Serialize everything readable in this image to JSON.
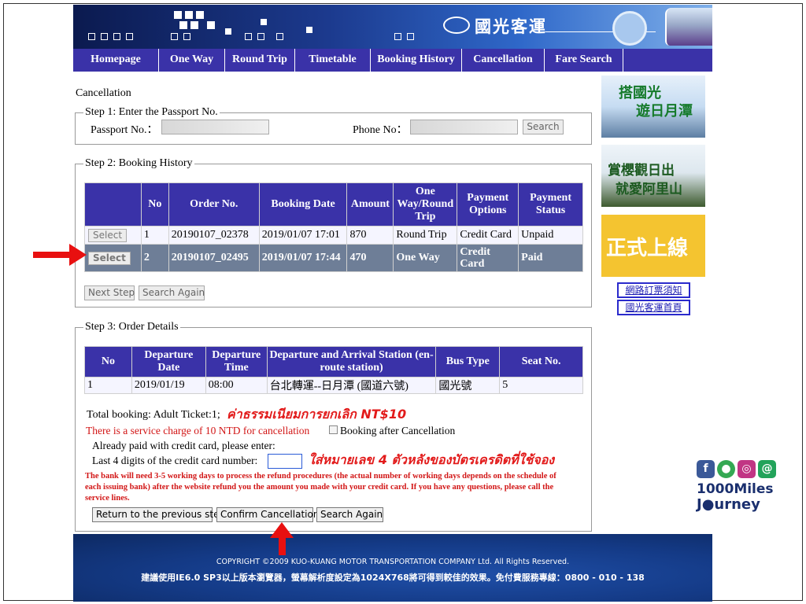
{
  "banner": {
    "logo_text": "國光客運"
  },
  "nav": [
    "Homepage",
    "One Way",
    "Round Trip",
    "Timetable",
    "Booking History",
    "Cancellation",
    "Fare Search"
  ],
  "page_title": "Cancellation",
  "step1": {
    "legend": "Step 1: Enter the Passport No.",
    "passport_label": "Passport No.：",
    "phone_label": "Phone No：",
    "search_button": "Search"
  },
  "step2": {
    "legend": "Step 2: Booking History",
    "headers": [
      "",
      "No",
      "Order No.",
      "Booking Date",
      "Amount",
      "One Way/Round Trip",
      "Payment Options",
      "Payment Status"
    ],
    "select_label": "Select",
    "rows": [
      {
        "no": "1",
        "order": "20190107_02378",
        "date": "2019/01/07 17:01",
        "amount": "870",
        "trip": "Round Trip",
        "payment": "Credit Card",
        "status": "Unpaid"
      },
      {
        "no": "2",
        "order": "20190107_02495",
        "date": "2019/01/07 17:44",
        "amount": "470",
        "trip": "One Way",
        "payment": "Credit Card",
        "status": "Paid"
      }
    ],
    "next_step": "Next Step",
    "search_again": "Search Again"
  },
  "step3": {
    "legend": "Step 3: Order Details",
    "headers": [
      "No",
      "Departure Date",
      "Departure Time",
      "Departure and Arrival Station (en-route station)",
      "Bus Type",
      "Seat No."
    ],
    "row": {
      "no": "1",
      "date": "2019/01/19",
      "time": "08:00",
      "station": "台北轉運--日月潭 (國道六號)",
      "bus_type": "國光號",
      "seat": "5"
    },
    "total_booking": "Total booking: Adult Ticket:1;",
    "service_charge": "There is a service charge of 10 NTD for cancellation",
    "booking_after": "Booking after Cancellation",
    "already_paid": "Already paid with credit card, please enter:",
    "last4_label": "Last 4 digits of the credit card number:",
    "bank_note": "The bank will need 3-5 working days to process the refund procedures (the actual number of working days depends on the schedule of each issuing bank) after the website refund you the amount you made with your credit card. If you have any questions, please call the service lines.",
    "btn_return": "Return to the previous step",
    "btn_confirm": "Confirm Cancellation",
    "btn_search_again": "Search Again"
  },
  "annotations": {
    "thai_fee": "ค่าธรรมเนียมการยกเลิก NT$10",
    "thai_card": "ใส่หมายเลข 4 ตัวหลังของบัตรเครดิตที่ใช้จอง"
  },
  "footer": {
    "copyright": "COPYRIGHT ©2009 KUO-KUANG MOTOR TRANSPORTATION COMPANY Ltd. All Rights Reserved.",
    "notice": "建議使用IE6.0 SP3以上版本瀏覽器，螢幕解析度設定為1024X768將可得到較佳的效果。免付費服務專線：0800 - 010 - 138"
  },
  "sidebar": {
    "ad1": [
      "搭國光",
      "遊日月潭"
    ],
    "ad2": [
      "賞櫻觀日出",
      "就愛阿里山"
    ],
    "ad3": "正式上線",
    "link1": "網路訂票須知",
    "link2": "國光客運首頁"
  },
  "brand": {
    "line1": "1000Miles",
    "line2": "J●urney"
  },
  "colors": {
    "nav": "#3a32a8",
    "selected_row": "#6e7e97",
    "annotation_red": "#e21a1a"
  }
}
